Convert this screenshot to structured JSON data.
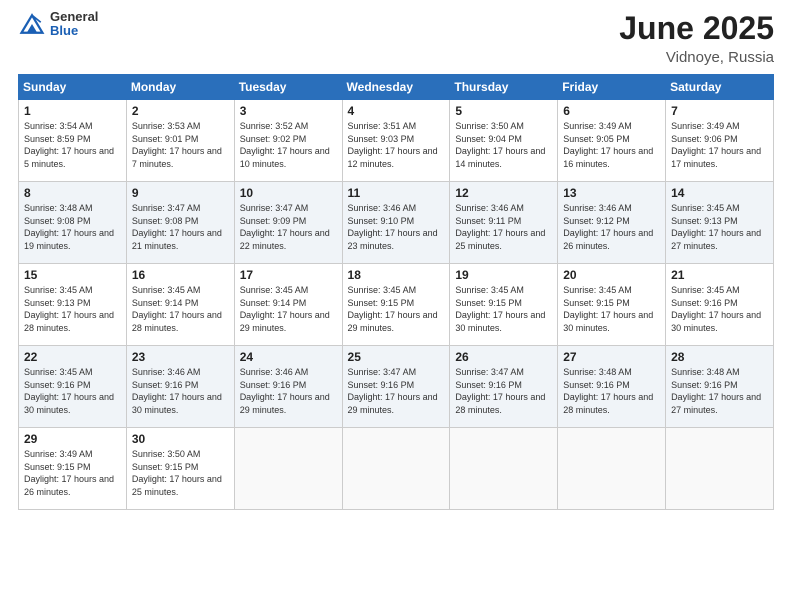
{
  "header": {
    "logo_general": "General",
    "logo_blue": "Blue",
    "title": "June 2025",
    "location": "Vidnoye, Russia"
  },
  "days_of_week": [
    "Sunday",
    "Monday",
    "Tuesday",
    "Wednesday",
    "Thursday",
    "Friday",
    "Saturday"
  ],
  "weeks": [
    [
      {
        "day": 1,
        "sunrise": "3:54 AM",
        "sunset": "8:59 PM",
        "daylight": "17 hours and 5 minutes."
      },
      {
        "day": 2,
        "sunrise": "3:53 AM",
        "sunset": "9:01 PM",
        "daylight": "17 hours and 7 minutes."
      },
      {
        "day": 3,
        "sunrise": "3:52 AM",
        "sunset": "9:02 PM",
        "daylight": "17 hours and 10 minutes."
      },
      {
        "day": 4,
        "sunrise": "3:51 AM",
        "sunset": "9:03 PM",
        "daylight": "17 hours and 12 minutes."
      },
      {
        "day": 5,
        "sunrise": "3:50 AM",
        "sunset": "9:04 PM",
        "daylight": "17 hours and 14 minutes."
      },
      {
        "day": 6,
        "sunrise": "3:49 AM",
        "sunset": "9:05 PM",
        "daylight": "17 hours and 16 minutes."
      },
      {
        "day": 7,
        "sunrise": "3:49 AM",
        "sunset": "9:06 PM",
        "daylight": "17 hours and 17 minutes."
      }
    ],
    [
      {
        "day": 8,
        "sunrise": "3:48 AM",
        "sunset": "9:08 PM",
        "daylight": "17 hours and 19 minutes."
      },
      {
        "day": 9,
        "sunrise": "3:47 AM",
        "sunset": "9:08 PM",
        "daylight": "17 hours and 21 minutes."
      },
      {
        "day": 10,
        "sunrise": "3:47 AM",
        "sunset": "9:09 PM",
        "daylight": "17 hours and 22 minutes."
      },
      {
        "day": 11,
        "sunrise": "3:46 AM",
        "sunset": "9:10 PM",
        "daylight": "17 hours and 23 minutes."
      },
      {
        "day": 12,
        "sunrise": "3:46 AM",
        "sunset": "9:11 PM",
        "daylight": "17 hours and 25 minutes."
      },
      {
        "day": 13,
        "sunrise": "3:46 AM",
        "sunset": "9:12 PM",
        "daylight": "17 hours and 26 minutes."
      },
      {
        "day": 14,
        "sunrise": "3:45 AM",
        "sunset": "9:13 PM",
        "daylight": "17 hours and 27 minutes."
      }
    ],
    [
      {
        "day": 15,
        "sunrise": "3:45 AM",
        "sunset": "9:13 PM",
        "daylight": "17 hours and 28 minutes."
      },
      {
        "day": 16,
        "sunrise": "3:45 AM",
        "sunset": "9:14 PM",
        "daylight": "17 hours and 28 minutes."
      },
      {
        "day": 17,
        "sunrise": "3:45 AM",
        "sunset": "9:14 PM",
        "daylight": "17 hours and 29 minutes."
      },
      {
        "day": 18,
        "sunrise": "3:45 AM",
        "sunset": "9:15 PM",
        "daylight": "17 hours and 29 minutes."
      },
      {
        "day": 19,
        "sunrise": "3:45 AM",
        "sunset": "9:15 PM",
        "daylight": "17 hours and 30 minutes."
      },
      {
        "day": 20,
        "sunrise": "3:45 AM",
        "sunset": "9:15 PM",
        "daylight": "17 hours and 30 minutes."
      },
      {
        "day": 21,
        "sunrise": "3:45 AM",
        "sunset": "9:16 PM",
        "daylight": "17 hours and 30 minutes."
      }
    ],
    [
      {
        "day": 22,
        "sunrise": "3:45 AM",
        "sunset": "9:16 PM",
        "daylight": "17 hours and 30 minutes."
      },
      {
        "day": 23,
        "sunrise": "3:46 AM",
        "sunset": "9:16 PM",
        "daylight": "17 hours and 30 minutes."
      },
      {
        "day": 24,
        "sunrise": "3:46 AM",
        "sunset": "9:16 PM",
        "daylight": "17 hours and 29 minutes."
      },
      {
        "day": 25,
        "sunrise": "3:47 AM",
        "sunset": "9:16 PM",
        "daylight": "17 hours and 29 minutes."
      },
      {
        "day": 26,
        "sunrise": "3:47 AM",
        "sunset": "9:16 PM",
        "daylight": "17 hours and 28 minutes."
      },
      {
        "day": 27,
        "sunrise": "3:48 AM",
        "sunset": "9:16 PM",
        "daylight": "17 hours and 28 minutes."
      },
      {
        "day": 28,
        "sunrise": "3:48 AM",
        "sunset": "9:16 PM",
        "daylight": "17 hours and 27 minutes."
      }
    ],
    [
      {
        "day": 29,
        "sunrise": "3:49 AM",
        "sunset": "9:15 PM",
        "daylight": "17 hours and 26 minutes."
      },
      {
        "day": 30,
        "sunrise": "3:50 AM",
        "sunset": "9:15 PM",
        "daylight": "17 hours and 25 minutes."
      },
      null,
      null,
      null,
      null,
      null
    ]
  ]
}
